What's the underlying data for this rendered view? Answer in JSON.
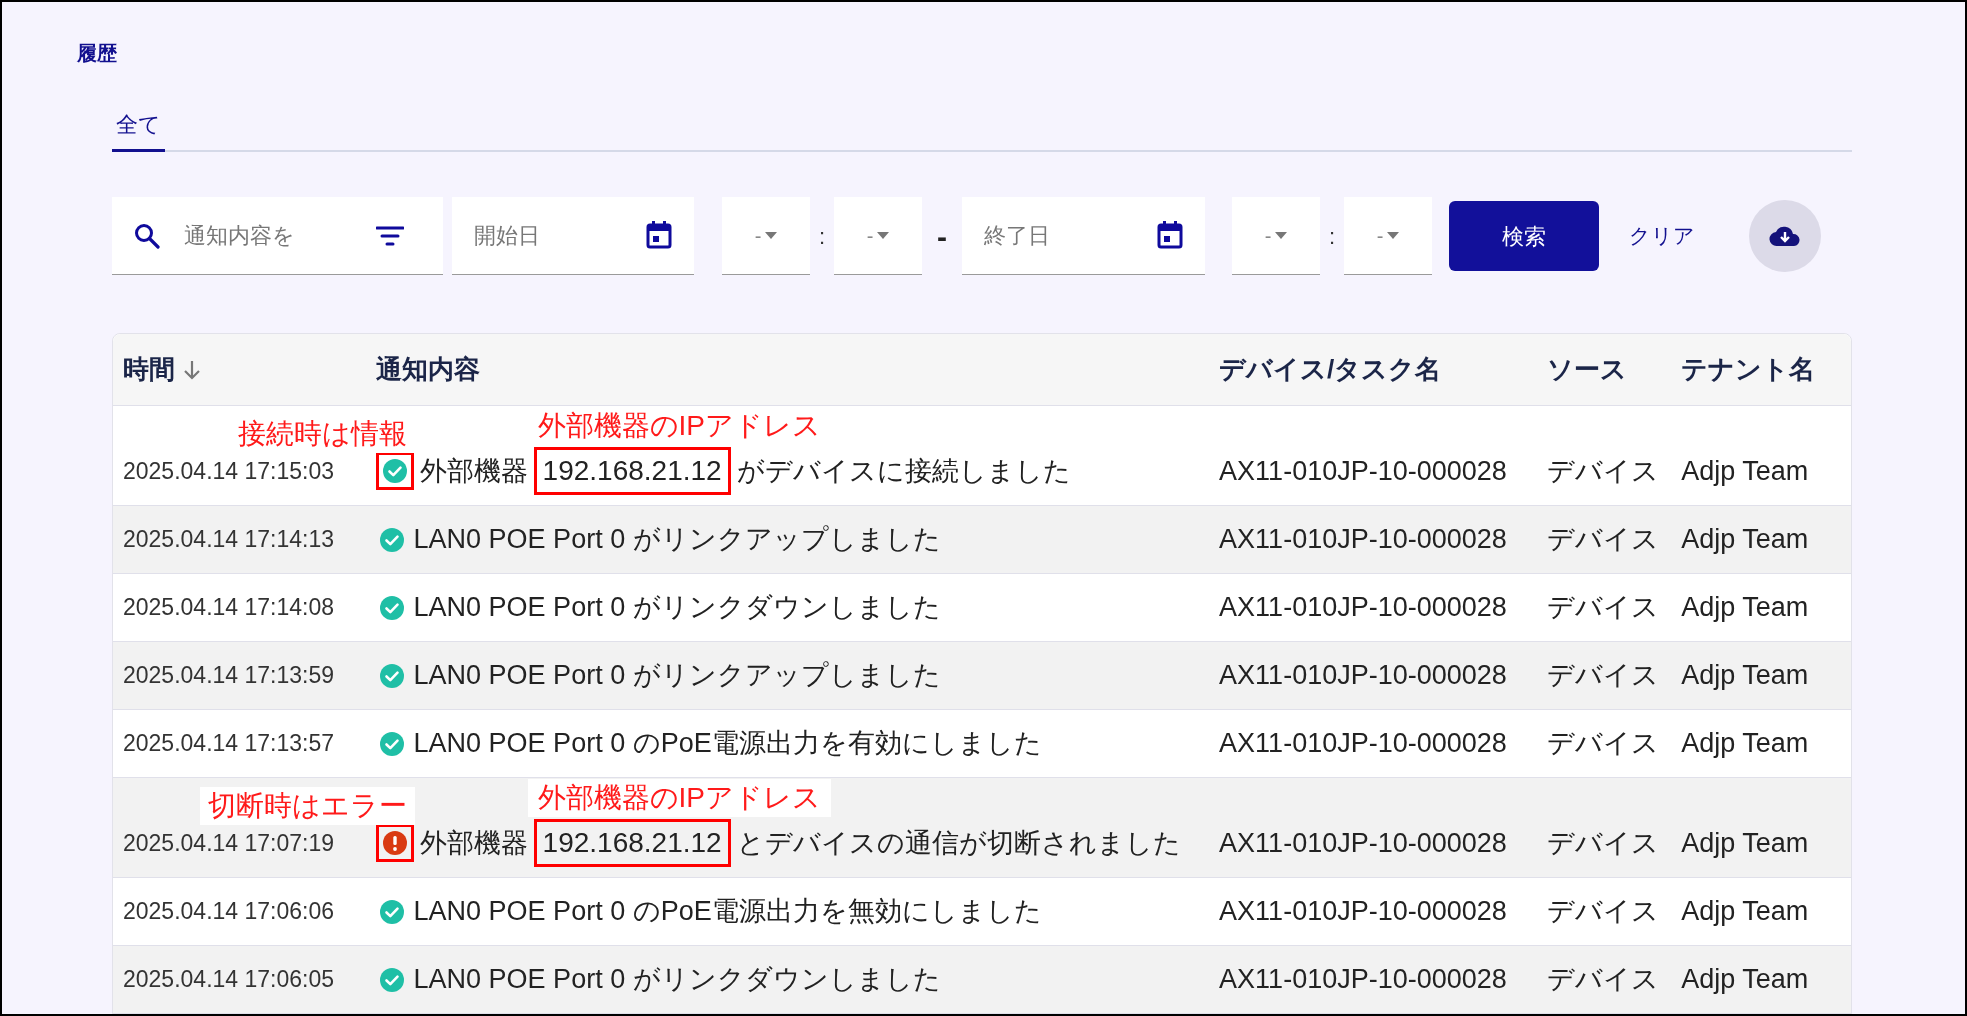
{
  "title": "履歴",
  "tabs": [
    {
      "label": "全て",
      "selected": true
    }
  ],
  "filters": {
    "search": {
      "placeholder": "通知内容を"
    },
    "start_date": {
      "placeholder": "開始日"
    },
    "start_hour": "-",
    "time_sep_1": ":",
    "start_minute": "-",
    "range_sep": "-",
    "end_date": {
      "placeholder": "終了日"
    },
    "end_hour": "-",
    "time_sep_2": ":",
    "end_minute": "-",
    "search_button": "検索",
    "clear_link": "クリア"
  },
  "table": {
    "columns": [
      {
        "label": "時間",
        "sorted": true
      },
      {
        "label": "通知内容",
        "sorted": false
      },
      {
        "label": "デバイス/タスク名",
        "sorted": false
      },
      {
        "label": "ソース",
        "sorted": false
      },
      {
        "label": "テナント名",
        "sorted": false
      }
    ],
    "rows": [
      {
        "time": "2025.04.14 17:15:03",
        "kind": "info",
        "message": "外部機器",
        "ip": "192.168.21.12",
        "suffix": "がデバイスに接続しました",
        "device": "AX11-010JP-10-000028",
        "source": "デバイス",
        "tenant": "Adjp Team",
        "icon_note": "接続時は情報",
        "ip_note": "外部機器のIPアドレス"
      },
      {
        "time": "2025.04.14 17:14:13",
        "kind": "info",
        "message": "LAN0 POE Port 0 がリンクアップしました",
        "device": "AX11-010JP-10-000028",
        "source": "デバイス",
        "tenant": "Adjp Team"
      },
      {
        "time": "2025.04.14 17:14:08",
        "kind": "info",
        "message": "LAN0 POE Port 0 がリンクダウンしました",
        "device": "AX11-010JP-10-000028",
        "source": "デバイス",
        "tenant": "Adjp Team"
      },
      {
        "time": "2025.04.14 17:13:59",
        "kind": "info",
        "message": "LAN0 POE Port 0 がリンクアップしました",
        "device": "AX11-010JP-10-000028",
        "source": "デバイス",
        "tenant": "Adjp Team"
      },
      {
        "time": "2025.04.14 17:13:57",
        "kind": "info",
        "message": "LAN0 POE Port 0 のPoE電源出力を有効にしました",
        "device": "AX11-010JP-10-000028",
        "source": "デバイス",
        "tenant": "Adjp Team"
      },
      {
        "time": "2025.04.14 17:07:19",
        "kind": "error",
        "message": "外部機器",
        "ip": "192.168.21.12",
        "suffix": "とデバイスの通信が切断されました",
        "device": "AX11-010JP-10-000028",
        "source": "デバイス",
        "tenant": "Adjp Team",
        "icon_note": "切断時はエラー",
        "ip_note": "外部機器のIPアドレス"
      },
      {
        "time": "2025.04.14 17:06:06",
        "kind": "info",
        "message": "LAN0 POE Port 0 のPoE電源出力を無効にしました",
        "device": "AX11-010JP-10-000028",
        "source": "デバイス",
        "tenant": "Adjp Team"
      },
      {
        "time": "2025.04.14 17:06:05",
        "kind": "info",
        "message": "LAN0 POE Port 0 がリンクダウンしました",
        "device": "AX11-010JP-10-000028",
        "source": "デバイス",
        "tenant": "Adjp Team"
      }
    ]
  }
}
